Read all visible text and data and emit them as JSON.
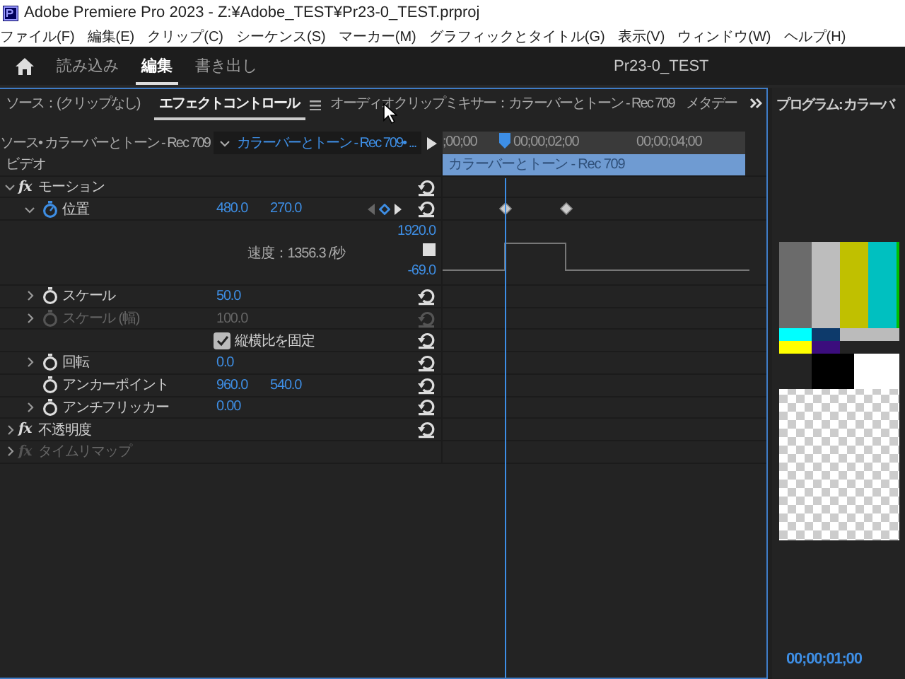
{
  "window": {
    "title": "Adobe Premiere Pro 2023 - Z:¥Adobe_TEST¥Pr23-0_TEST.prproj"
  },
  "menu": [
    "ファイル(F)",
    "編集(E)",
    "クリップ(C)",
    "シーケンス(S)",
    "マーカー(M)",
    "グラフィックとタイトル(G)",
    "表示(V)",
    "ウィンドウ(W)",
    "ヘルプ(H)"
  ],
  "workspace": {
    "tabs": [
      {
        "label": "読み込み",
        "selected": false
      },
      {
        "label": "編集",
        "selected": true
      },
      {
        "label": "書き出し",
        "selected": false
      }
    ],
    "project": "Pr23-0_TEST"
  },
  "effect_panel": {
    "tabs": [
      {
        "label": "ソース：(クリップなし)",
        "selected": false
      },
      {
        "label": "エフェクトコントロール",
        "selected": true
      },
      {
        "label": "オーディオクリップミキサー：カラーバーとトーン - Rec 709",
        "selected": false
      },
      {
        "label": "メタデー",
        "selected": false
      }
    ],
    "source_label": "ソース• カラーバーとトーン - Rec 709",
    "clip_dropdown": "カラーバーとトーン - Rec 709• ...",
    "ruler": [
      ";00;00",
      "00;00;02;00",
      "00;00;04;00"
    ],
    "section": "ビデオ",
    "clip_bar": "カラーバーとトーン - Rec 709",
    "rows": [
      {
        "kind": "effect",
        "badge": "fx",
        "label": "モーション",
        "expanded": true,
        "disabled": false
      },
      {
        "kind": "property",
        "label": "位置",
        "expanded": true,
        "animated": true,
        "disabled": false,
        "values": [
          "480.0",
          "270.0"
        ]
      },
      {
        "kind": "graph",
        "max": "1920.0",
        "velocity": "速度：1356.3 /秒",
        "min": "-69.0"
      },
      {
        "kind": "property",
        "label": "スケール",
        "expanded": false,
        "animated": false,
        "disabled": false,
        "values": [
          "50.0"
        ]
      },
      {
        "kind": "property",
        "label": "スケール (幅)",
        "expanded": false,
        "animated": false,
        "disabled": true,
        "values": [
          "100.0"
        ]
      },
      {
        "kind": "checkbox",
        "label": "縦横比を固定",
        "checked": true
      },
      {
        "kind": "property",
        "label": "回転",
        "expanded": false,
        "animated": false,
        "disabled": false,
        "values": [
          "0.0"
        ]
      },
      {
        "kind": "property",
        "label": "アンカーポイント",
        "animated": false,
        "disabled": false,
        "values": [
          "960.0",
          "540.0"
        ]
      },
      {
        "kind": "property",
        "label": "アンチフリッカー",
        "expanded": false,
        "animated": false,
        "disabled": false,
        "values": [
          "0.00"
        ]
      },
      {
        "kind": "effect",
        "badge": "fx",
        "label": "不透明度",
        "expanded": false,
        "disabled": false
      },
      {
        "kind": "effect",
        "badge": "fx",
        "label": "タイムリマップ",
        "expanded": false,
        "disabled": true
      }
    ]
  },
  "program": {
    "title": "プログラム: カラーバ",
    "timecode": "00;00;01;00"
  }
}
